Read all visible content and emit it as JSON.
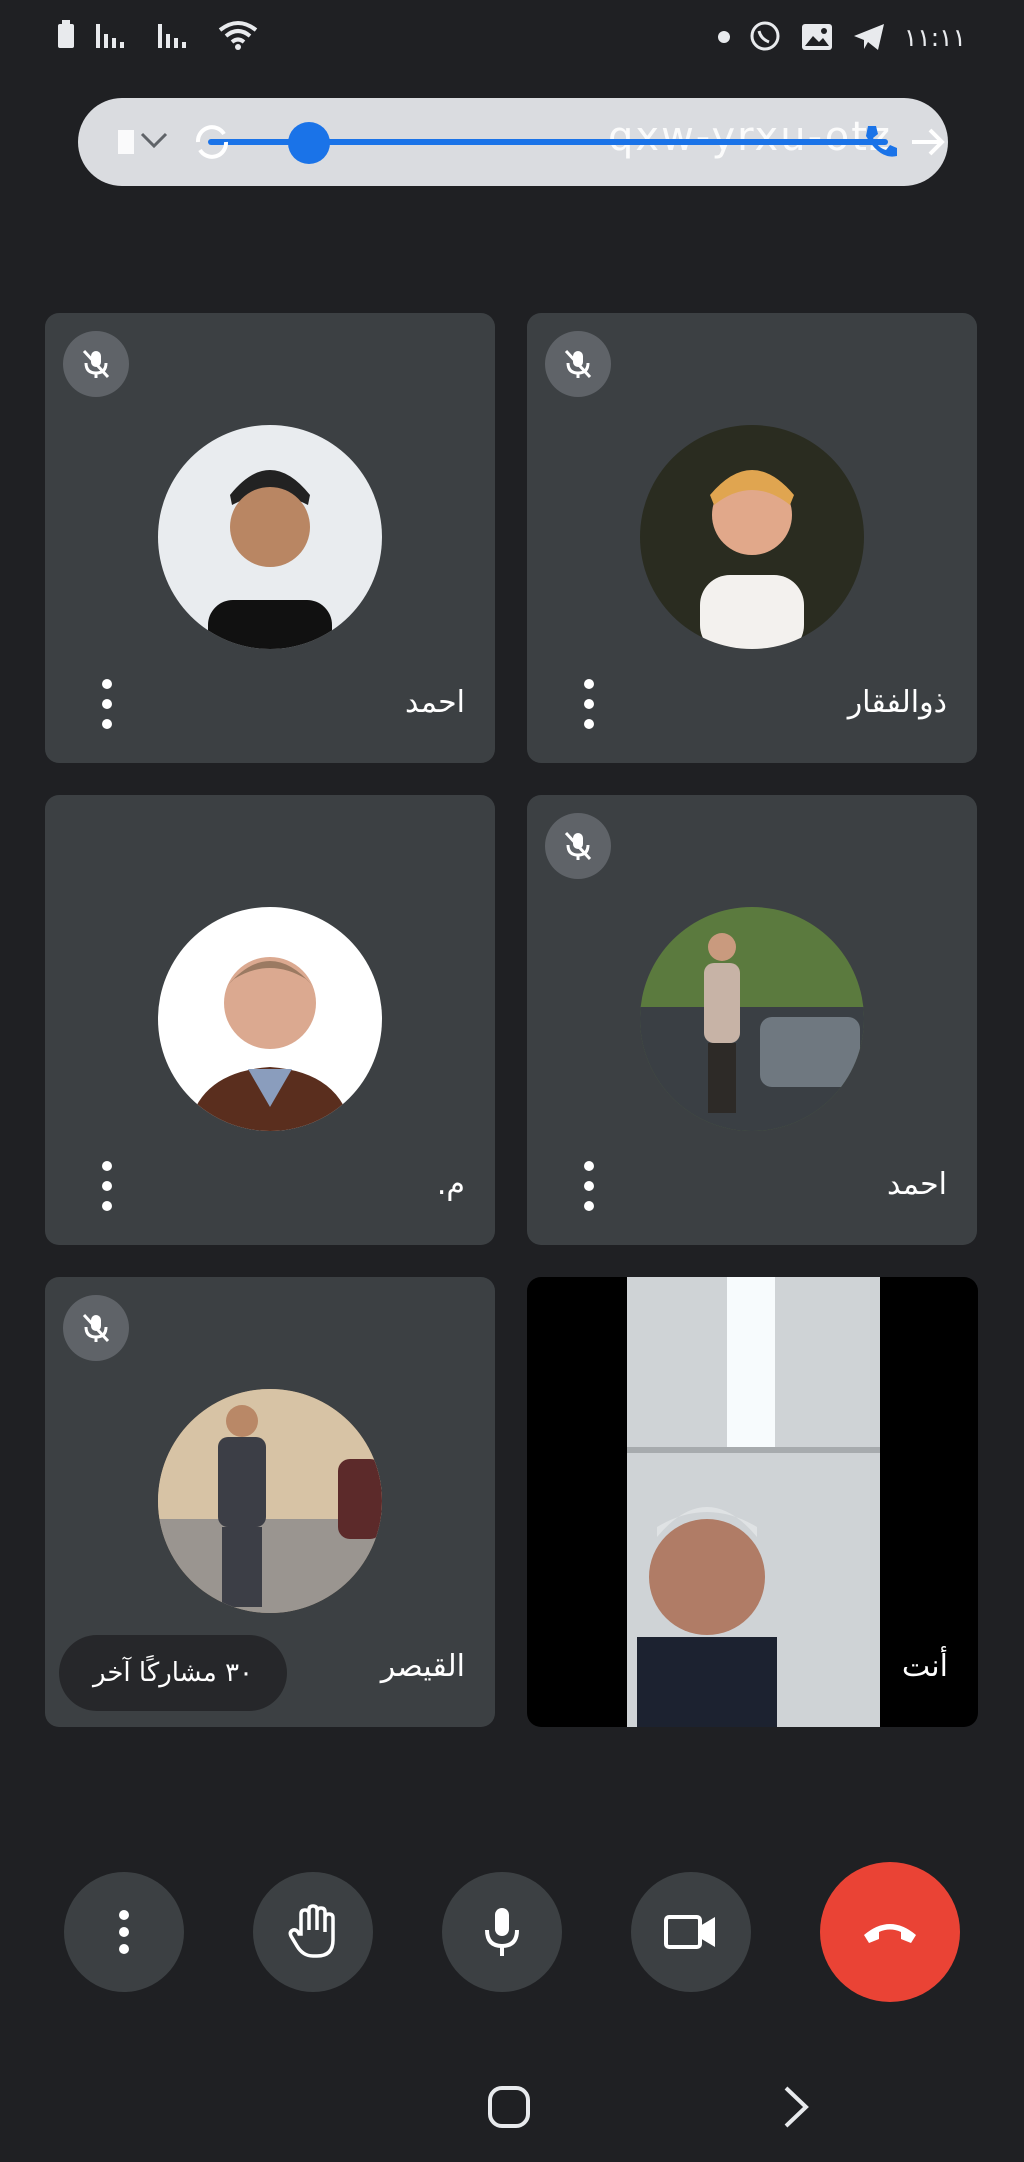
{
  "status_bar": {
    "time": "١١:١١",
    "left_icons": [
      "sim-icon",
      "signal-icon",
      "signal-icon",
      "wifi-icon"
    ],
    "right_icons": [
      "dot-icon",
      "viber-icon",
      "gallery-icon",
      "telegram-icon"
    ]
  },
  "meeting_bar": {
    "meeting_code": "qxw-yrxu-otz",
    "icons": [
      "chevron-down-icon",
      "rotate-icon",
      "phone-icon",
      "arrow-right-icon"
    ]
  },
  "participants": [
    {
      "name": "ذوالفقار",
      "muted": true,
      "avatar_bg": "#2a2c20"
    },
    {
      "name": "احمد",
      "muted": true,
      "avatar_bg": "#e9ecef"
    },
    {
      "name": "احمد",
      "muted": true,
      "avatar_bg": "#5b7a3e"
    },
    {
      "name": "م.",
      "muted": false,
      "avatar_bg": "#ffffff"
    },
    {
      "name": "القيصر",
      "muted": true,
      "avatar_bg": "#b39a7a"
    }
  ],
  "self_view": {
    "label": "أنت"
  },
  "others_chip": "٣٠ مشاركًا آخر",
  "controls": [
    "more-options-icon",
    "raise-hand-icon",
    "microphone-icon",
    "camera-icon",
    "hang-up-icon"
  ],
  "colors": {
    "accent": "#1a73e8",
    "hangup": "#ea4335",
    "tile": "#3c4043",
    "background": "#1f2023"
  }
}
